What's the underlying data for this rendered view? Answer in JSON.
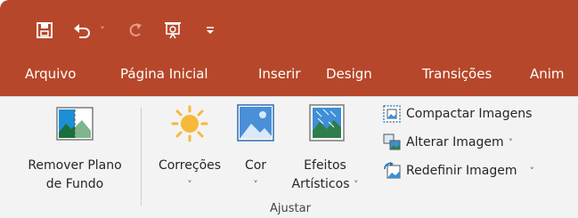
{
  "colors": {
    "accent": "#b7472a",
    "ribbon": "#f3f3f3",
    "text": "#262626"
  },
  "qat": {
    "save_icon": "save-icon",
    "undo_icon": "undo-icon",
    "redo_icon": "redo-icon",
    "slideshow_icon": "present-from-start-icon",
    "customize_icon": "customize-quick-access-icon"
  },
  "tabs": [
    "Arquivo",
    "Página Inicial",
    "Inserir",
    "Design",
    "Transições",
    "Anim"
  ],
  "ribbon": {
    "remove_bg": {
      "line1": "Remover Plano",
      "line2": "de Fundo"
    },
    "corrections": {
      "label": "Correções"
    },
    "color": {
      "label": "Cor"
    },
    "artistic": {
      "line1": "Efeitos",
      "line2": "Artísticos"
    },
    "compress": "Compactar Imagens",
    "change": "Alterar Imagem",
    "reset": "Redefinir Imagem",
    "group_label": "Ajustar"
  },
  "chevron": "˅"
}
